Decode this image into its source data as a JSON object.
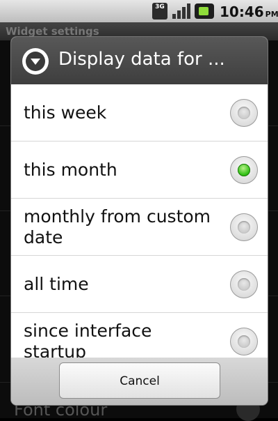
{
  "status_bar": {
    "network_label": "3G",
    "time": "10:46",
    "ampm": "PM"
  },
  "background": {
    "header_title": "Widget settings",
    "font_colour_label": "Font colour"
  },
  "dialog": {
    "title": "Display data for ...",
    "options": [
      {
        "label": "this week",
        "selected": false
      },
      {
        "label": "this month",
        "selected": true
      },
      {
        "label": "monthly from custom date",
        "selected": false
      },
      {
        "label": "all time",
        "selected": false
      },
      {
        "label": "since interface startup",
        "selected": false
      }
    ],
    "cancel_label": "Cancel"
  },
  "colors": {
    "selected_radio": "#34c217",
    "dialog_header": "#484848"
  }
}
